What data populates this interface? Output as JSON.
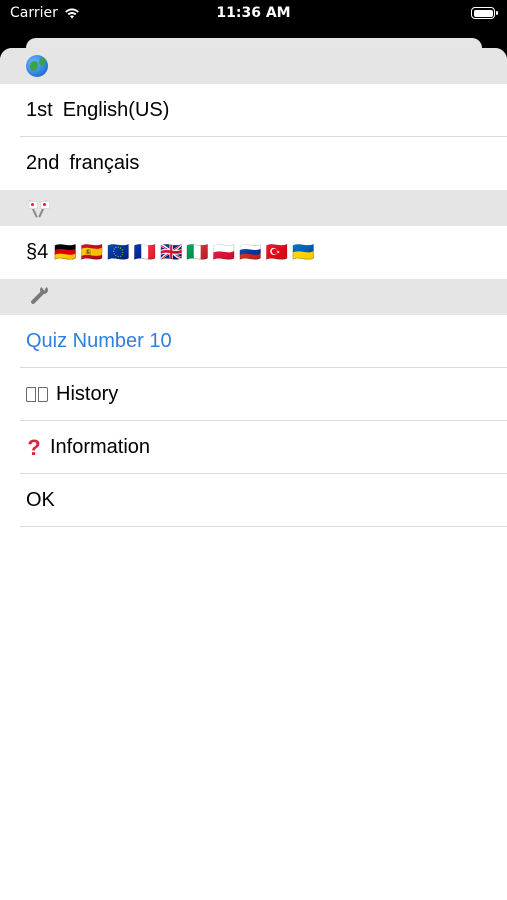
{
  "status_bar": {
    "carrier": "Carrier",
    "time": "11:36 AM"
  },
  "sections": {
    "language_header_icon": "globe-icon",
    "flags_header_icon": "crossed-flags-icon",
    "settings_header_icon": "wrench-icon"
  },
  "language_rows": [
    {
      "ordinal": "1st",
      "language": "English(US)"
    },
    {
      "ordinal": "2nd",
      "language": "français"
    }
  ],
  "flags_row": {
    "prefix": "§4",
    "flags": [
      "🇩🇪",
      "🇪🇸",
      "🇪🇺",
      "🇫🇷",
      "🇬🇧",
      "🇮🇹",
      "🇵🇱",
      "🇷🇺",
      "🇹🇷",
      "🇺🇦"
    ]
  },
  "settings_rows": {
    "quiz": "Quiz Number 10",
    "history": "History",
    "information": "Information",
    "ok": "OK"
  },
  "colors": {
    "link": "#2f7fdc",
    "header_bg": "#e5e5e5"
  }
}
